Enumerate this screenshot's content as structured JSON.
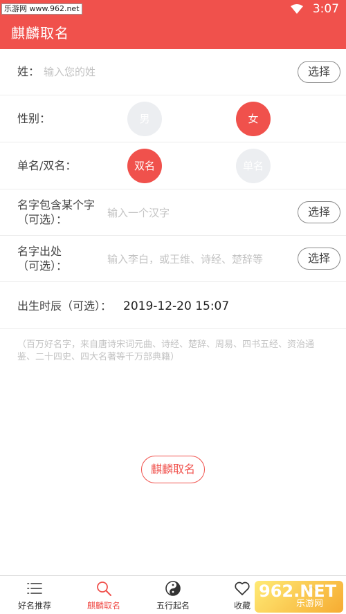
{
  "status_bar": {
    "watermark": "乐游网 www.962.net",
    "time": "3:07"
  },
  "app_bar": {
    "title": "麒麟取名"
  },
  "form": {
    "surname": {
      "label": "姓：",
      "placeholder": "输入您的姓",
      "button": "选择"
    },
    "gender": {
      "label": "性别：",
      "options": [
        "男",
        "女"
      ],
      "selected": "女"
    },
    "name_type": {
      "label": "单名/双名：",
      "options": [
        "双名",
        "单名"
      ],
      "selected": "双名"
    },
    "contains_char": {
      "label_line1": "名字包含某个字",
      "label_line2": "（可选）：",
      "placeholder": "输入一个汉字",
      "button": "选择"
    },
    "source": {
      "label_line1": "名字出处",
      "label_line2": "（可选）：",
      "placeholder": "输入李白，或王维、诗经、楚辞等",
      "button": "选择"
    },
    "birth": {
      "label": "出生时辰（可选）：",
      "value": "2019-12-20 15:07"
    },
    "hint": "（百万好名字，来自唐诗宋词元曲、诗经、楚辞、周易、四书五经、资治通鉴、二十四史、四大名著等千万部典籍）"
  },
  "main_button": "麒麟取名",
  "bottom_nav": {
    "items": [
      {
        "label": "好名推荐",
        "icon": "list-icon"
      },
      {
        "label": "麒麟取名",
        "icon": "search-icon",
        "active": true
      },
      {
        "label": "五行起名",
        "icon": "yin-yang-icon"
      },
      {
        "label": "收藏",
        "icon": "heart-icon"
      },
      {
        "label": "",
        "icon": "chevron-up-icon"
      }
    ]
  },
  "watermark": {
    "big": "962.NET",
    "small": "乐游网"
  },
  "colors": {
    "accent": "#f0514c",
    "inactive_circle": "#eceef1",
    "placeholder": "#c3c3c3"
  }
}
